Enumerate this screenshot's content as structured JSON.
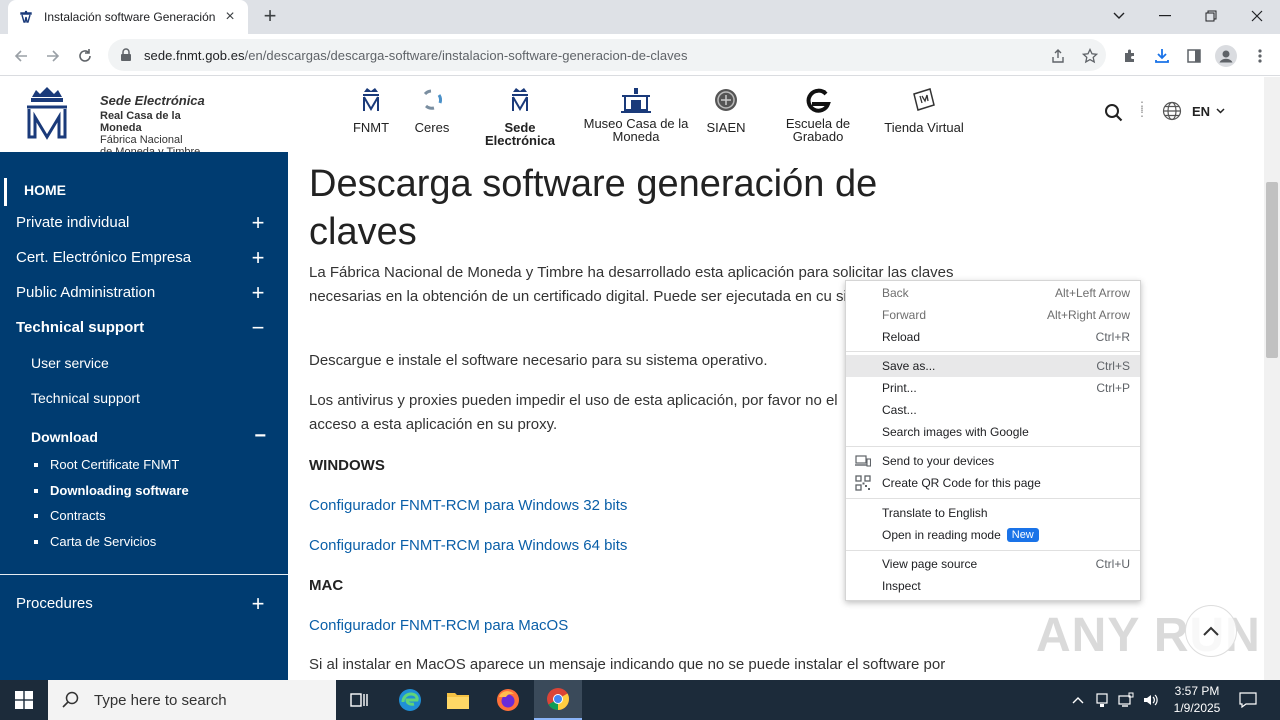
{
  "browser": {
    "tab_title": "Instalación software Generación",
    "url_host": "sede.fnmt.gob.es",
    "url_path": "/en/descargas/descarga-software/instalacion-software-generacion-de-claves"
  },
  "site": {
    "logo": {
      "line1": "Sede Electrónica",
      "line2": "Real Casa de la Moneda",
      "line3": "Fábrica Nacional",
      "line4": "de Moneda y Timbre"
    },
    "nav": [
      {
        "label": "FNMT"
      },
      {
        "label": "Ceres"
      },
      {
        "label": "Sede Electrónica"
      },
      {
        "label": "Museo Casa de la Moneda"
      },
      {
        "label": "SIAEN"
      },
      {
        "label": "Escuela de Grabado"
      },
      {
        "label": "Tienda Virtual"
      }
    ],
    "language": "EN"
  },
  "sidebar": {
    "home": "HOME",
    "items": [
      {
        "label": "Private individual",
        "toggle": "+"
      },
      {
        "label": "Cert. Electrónico Empresa",
        "toggle": "+"
      },
      {
        "label": "Public Administration",
        "toggle": "+"
      },
      {
        "label": "Technical support",
        "toggle": "−"
      },
      {
        "label": "Procedures",
        "toggle": "+"
      }
    ],
    "sub_items": [
      {
        "label": "User service"
      },
      {
        "label": "Technical support"
      },
      {
        "label": "Download",
        "toggle": "−"
      }
    ],
    "download_items": [
      {
        "label": "Root Certificate FNMT"
      },
      {
        "label": "Downloading software"
      },
      {
        "label": "Contracts"
      },
      {
        "label": "Carta de Servicios"
      }
    ]
  },
  "content": {
    "title": "Descarga software generación de claves",
    "p1": "La Fábrica Nacional de Moneda y Timbre ha desarrollado esta aplicación para solicitar las claves necesarias en la obtención de un certificado digital. Puede ser ejecutada en cu sistema Operativo.",
    "p2": "Descargue e instale el software necesario para su sistema operativo.",
    "p3": "Los antivirus y proxies pueden impedir el uso de esta aplicación, por favor no el acceso a esta aplicación en su proxy.",
    "windows_heading": "WINDOWS",
    "link_win32": "Configurador FNMT-RCM para Windows 32 bits",
    "link_win64": "Configurador FNMT-RCM para Windows 64 bits",
    "mac_heading": "MAC",
    "link_mac": "Configurador FNMT-RCM para MacOS",
    "p4": "Si al instalar en MacOS aparece un mensaje indicando que no se puede instalar el software por"
  },
  "context_menu": {
    "items": [
      {
        "label": "Back",
        "shortcut": "Alt+Left Arrow"
      },
      {
        "label": "Forward",
        "shortcut": "Alt+Right Arrow"
      },
      {
        "label": "Reload",
        "shortcut": "Ctrl+R"
      },
      {
        "label": "Save as...",
        "shortcut": "Ctrl+S"
      },
      {
        "label": "Print...",
        "shortcut": "Ctrl+P"
      },
      {
        "label": "Cast..."
      },
      {
        "label": "Search images with Google"
      },
      {
        "label": "Send to your devices"
      },
      {
        "label": "Create QR Code for this page"
      },
      {
        "label": "Translate to English"
      },
      {
        "label": "Open in reading mode",
        "badge": "New"
      },
      {
        "label": "View page source",
        "shortcut": "Ctrl+U"
      },
      {
        "label": "Inspect"
      }
    ]
  },
  "watermark": "ANY RUN",
  "taskbar": {
    "search_placeholder": "Type here to search",
    "time": "3:57 PM",
    "date": "1/9/2025"
  }
}
